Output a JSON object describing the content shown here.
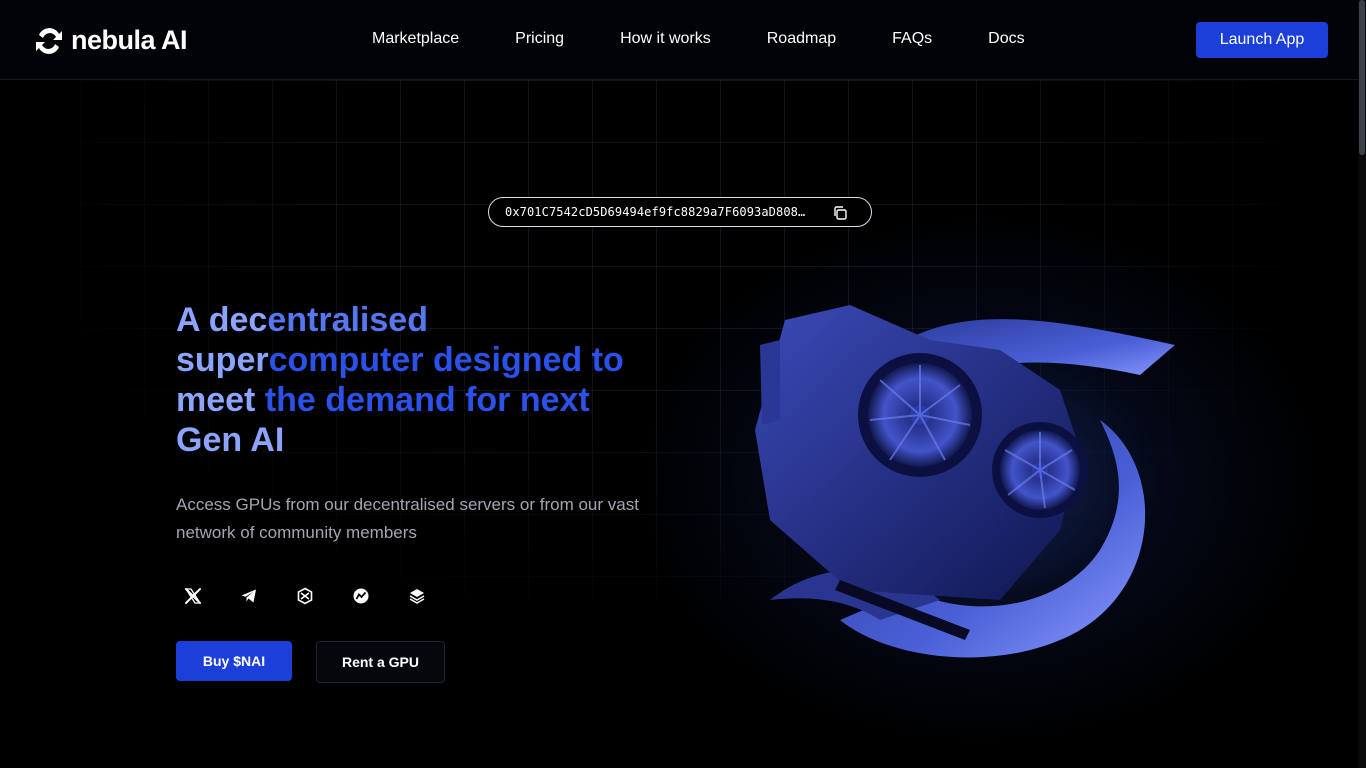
{
  "brand": {
    "name": "nebula",
    "suffix": "AI",
    "icon": "nebula-logo-icon"
  },
  "nav": {
    "items": [
      {
        "label": "Marketplace"
      },
      {
        "label": "Pricing"
      },
      {
        "label": "How it works"
      },
      {
        "label": "Roadmap"
      },
      {
        "label": "FAQs"
      },
      {
        "label": "Docs"
      }
    ],
    "cta_label": "Launch App"
  },
  "hero": {
    "contract_address": "0x701C7542cD5D69494ef9fc8829a7F6093aD808…",
    "copy_icon": "copy-icon",
    "headline": {
      "w1": "A ",
      "w2": "dec",
      "w3": "entralised",
      "w4": "super",
      "w5": "computer designed to",
      "w6": "meet ",
      "w7": "the demand for next",
      "w8": "Gen AI"
    },
    "subtitle": "Access GPUs from our decentralised servers or from our vast network of community members",
    "socials": [
      {
        "icon": "x-twitter-icon"
      },
      {
        "icon": "telegram-icon"
      },
      {
        "icon": "dextools-icon"
      },
      {
        "icon": "dexscreener-icon"
      },
      {
        "icon": "layers-icon"
      }
    ],
    "buy_label": "Buy $NAI",
    "rent_label": "Rent a GPU",
    "art": "gpu-3d-illustration"
  },
  "colors": {
    "accent": "#1b3fd8",
    "headline_light": "#8aa4ff",
    "headline_dark": "#2a52ea",
    "background": "#000000"
  }
}
